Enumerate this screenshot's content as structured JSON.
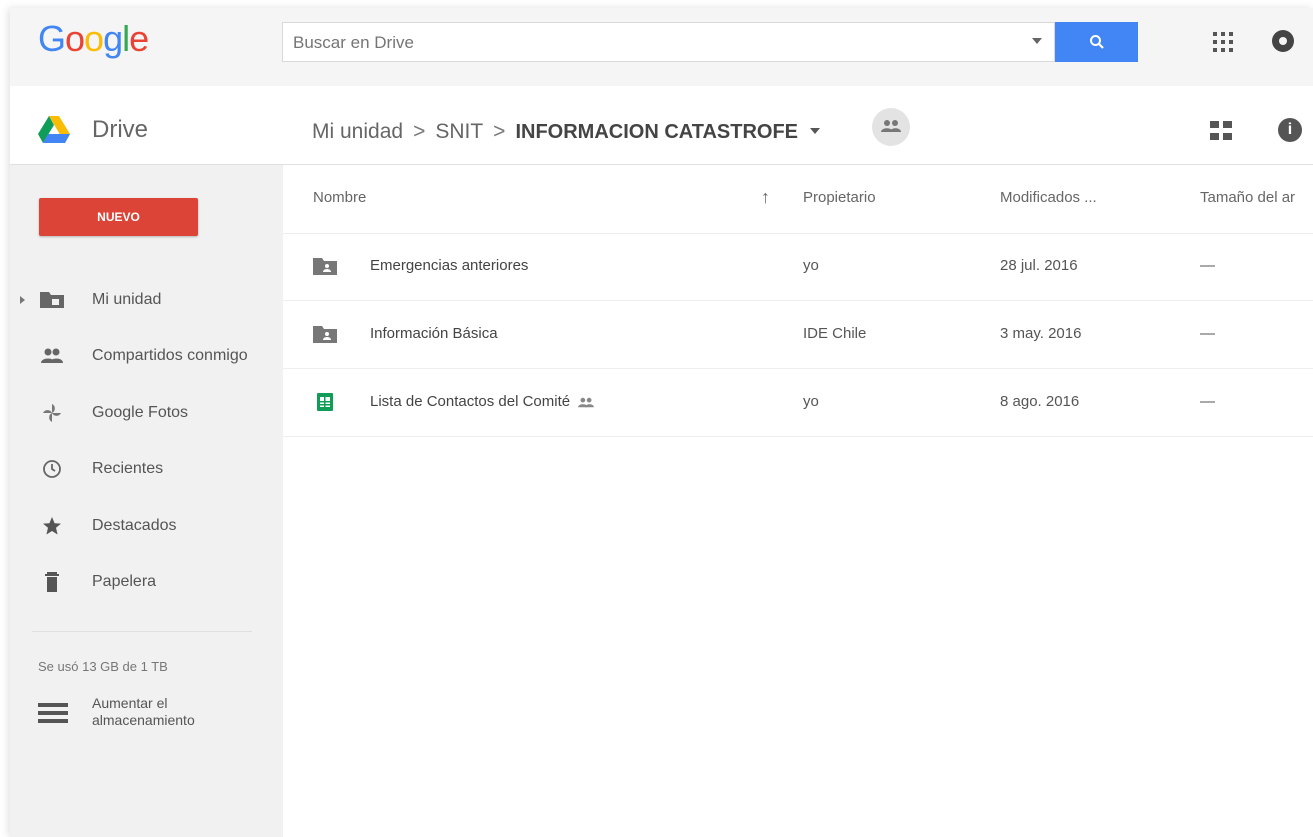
{
  "header": {
    "logo_letters": [
      {
        "ch": "G",
        "color": "#4285f4"
      },
      {
        "ch": "o",
        "color": "#ea4335"
      },
      {
        "ch": "o",
        "color": "#fbbc05"
      },
      {
        "ch": "g",
        "color": "#4285f4"
      },
      {
        "ch": "l",
        "color": "#34a853"
      },
      {
        "ch": "e",
        "color": "#ea4335"
      }
    ],
    "search_placeholder": "Buscar en Drive",
    "search_button_icon": "search-icon",
    "apps_icon": "apps-grid-icon",
    "notifications_icon": "notifications-icon"
  },
  "subheader": {
    "product_name": "Drive",
    "breadcrumb": [
      "Mi unidad",
      "SNIT",
      "INFORMACION CATASTROFE"
    ],
    "separator": ">",
    "grid_view_icon": "grid-view-icon",
    "info_icon": "info-icon"
  },
  "sidebar": {
    "new_button": "NUEVO",
    "items": [
      {
        "label": "Mi unidad",
        "icon": "my-drive-folder-icon"
      },
      {
        "label": "Compartidos conmigo",
        "icon": "shared-people-icon"
      },
      {
        "label": "Google Fotos",
        "icon": "google-photos-icon"
      },
      {
        "label": "Recientes",
        "icon": "clock-icon"
      },
      {
        "label": "Destacados",
        "icon": "star-icon"
      },
      {
        "label": "Papelera",
        "icon": "trash-icon"
      }
    ],
    "storage_text": "Se usó 13 GB de 1 TB",
    "upgrade_label": "Aumentar el almacenamiento"
  },
  "table": {
    "columns": {
      "name": "Nombre",
      "owner": "Propietario",
      "modified": "Modificados ...",
      "size": "Tamaño del ar"
    },
    "sort_icon": "arrow-up-icon",
    "rows": [
      {
        "name": "Emergencias anteriores",
        "owner": "yo",
        "modified": "28 jul. 2016",
        "size": "—",
        "type": "shared-folder"
      },
      {
        "name": "Información Básica",
        "owner": "IDE Chile",
        "modified": "3 may. 2016",
        "size": "—",
        "type": "shared-folder"
      },
      {
        "name": "Lista de Contactos del Comité",
        "owner": "yo",
        "modified": "8 ago. 2016",
        "size": "—",
        "type": "spreadsheet",
        "shared": true
      }
    ]
  },
  "colors": {
    "accent_blue": "#4285f4",
    "new_button_red": "#db4437",
    "sheets_green": "#0f9d58"
  }
}
